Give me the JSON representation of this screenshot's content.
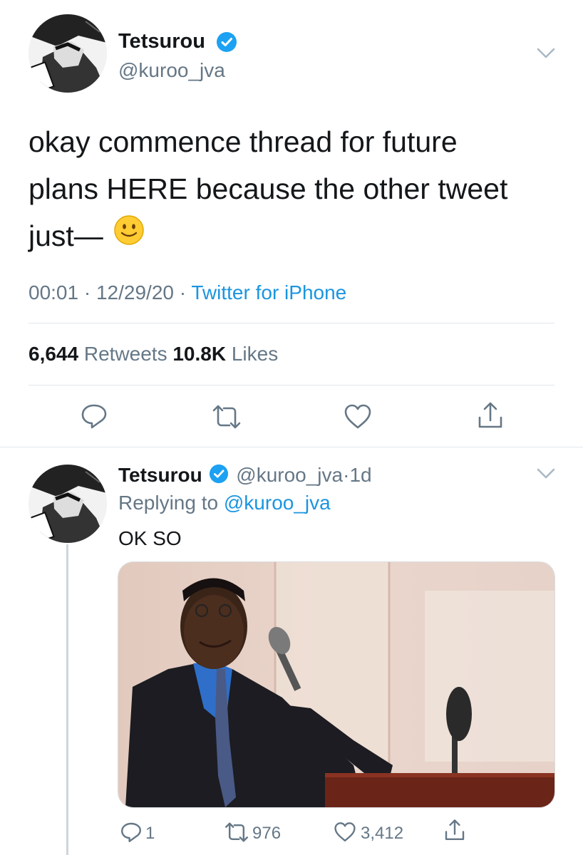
{
  "main_tweet": {
    "display_name": "Tetsurou",
    "handle": "@kuroo_jva",
    "text_line1": "okay commence thread for future",
    "text_line2": "plans HERE because the other tweet",
    "text_line3": "just—",
    "emoji": "🙂",
    "time": "00:01",
    "date": "12/29/20",
    "sep": "·",
    "source": "Twitter for iPhone",
    "retweets_count": "6,644",
    "retweets_label": "Retweets",
    "likes_count": "10.8K",
    "likes_label": "Likes"
  },
  "reply_tweet": {
    "display_name": "Tetsurou",
    "handle": "@kuroo_jva",
    "dot": "·",
    "age": "1d",
    "replying_prefix": "Replying to",
    "replying_handle": "@kuroo_jva",
    "text": "OK SO",
    "reply_count": "1",
    "retweet_count": "976",
    "like_count": "3,412"
  },
  "colors": {
    "link_blue": "#1b95e0",
    "gray_text": "#657786",
    "verified_blue": "#1da1f2",
    "divider": "#e1e8ed"
  },
  "icons": [
    "verified-badge-icon",
    "chevron-down-icon",
    "reply-icon",
    "retweet-icon",
    "like-icon",
    "share-icon"
  ]
}
